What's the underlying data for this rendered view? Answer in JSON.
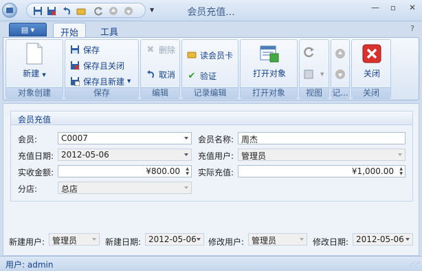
{
  "window": {
    "title": "会员充值..."
  },
  "ribbon_tabs": [
    "开始",
    "工具"
  ],
  "groups": {
    "create": {
      "label": "对象创建",
      "new_label": "新建"
    },
    "save": {
      "label": "保存",
      "save": "保存",
      "save_close": "保存且关闭",
      "save_new": "保存且新建"
    },
    "edit": {
      "label": "编辑",
      "delete": "删除",
      "cancel": "取消"
    },
    "record_edit": {
      "label": "记录编辑",
      "read_card": "读会员卡",
      "verify": "验证"
    },
    "open_object": {
      "label": "打开对象",
      "open": "打开对象"
    },
    "view": {
      "label": "视图"
    },
    "record": {
      "label": "记..."
    },
    "close": {
      "label": "关闭",
      "close": "关闭"
    }
  },
  "form": {
    "section_title": "会员充值",
    "member_label": "会员:",
    "member_value": "C0007",
    "member_name_label": "会员名称:",
    "member_name_value": "周杰",
    "date_label": "充值日期:",
    "date_value": "2012-05-06",
    "recharge_user_label": "充值用户:",
    "recharge_user_value": "管理员",
    "paid_label": "实收金额:",
    "paid_value": "¥800.00",
    "actual_label": "实际充值:",
    "actual_value": "¥1,000.00",
    "branch_label": "分店:",
    "branch_value": "总店"
  },
  "footer": {
    "created_by_label": "新建用户:",
    "created_by_value": "管理员",
    "created_date_label": "新建日期:",
    "created_date_value": "2012-05-06",
    "modified_by_label": "修改用户:",
    "modified_by_value": "管理员",
    "modified_date_label": "修改日期:",
    "modified_date_value": "2012-05-06"
  },
  "status": {
    "user": "用户: admin"
  },
  "colors": {
    "ribbon_text": "#15428b",
    "close_red": "#d9322c"
  }
}
